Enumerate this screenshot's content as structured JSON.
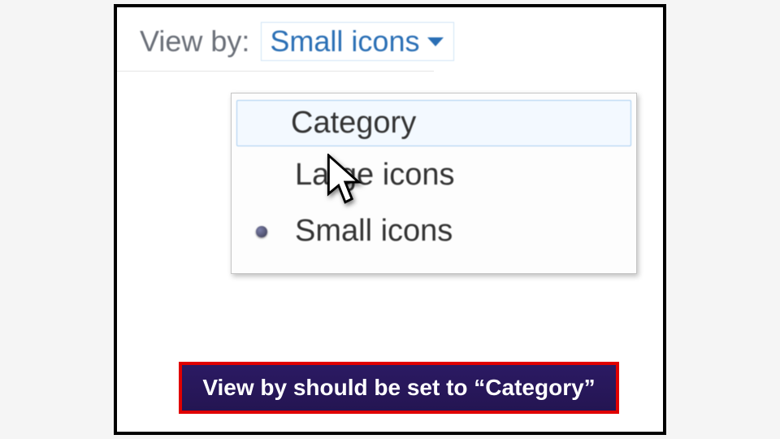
{
  "viewby": {
    "label": "View by:",
    "selected": "Small icons"
  },
  "menu": {
    "items": [
      {
        "label": "Category"
      },
      {
        "label": "Large icons"
      },
      {
        "label": "Small icons"
      }
    ]
  },
  "caption": "View by should be set to “Category”"
}
